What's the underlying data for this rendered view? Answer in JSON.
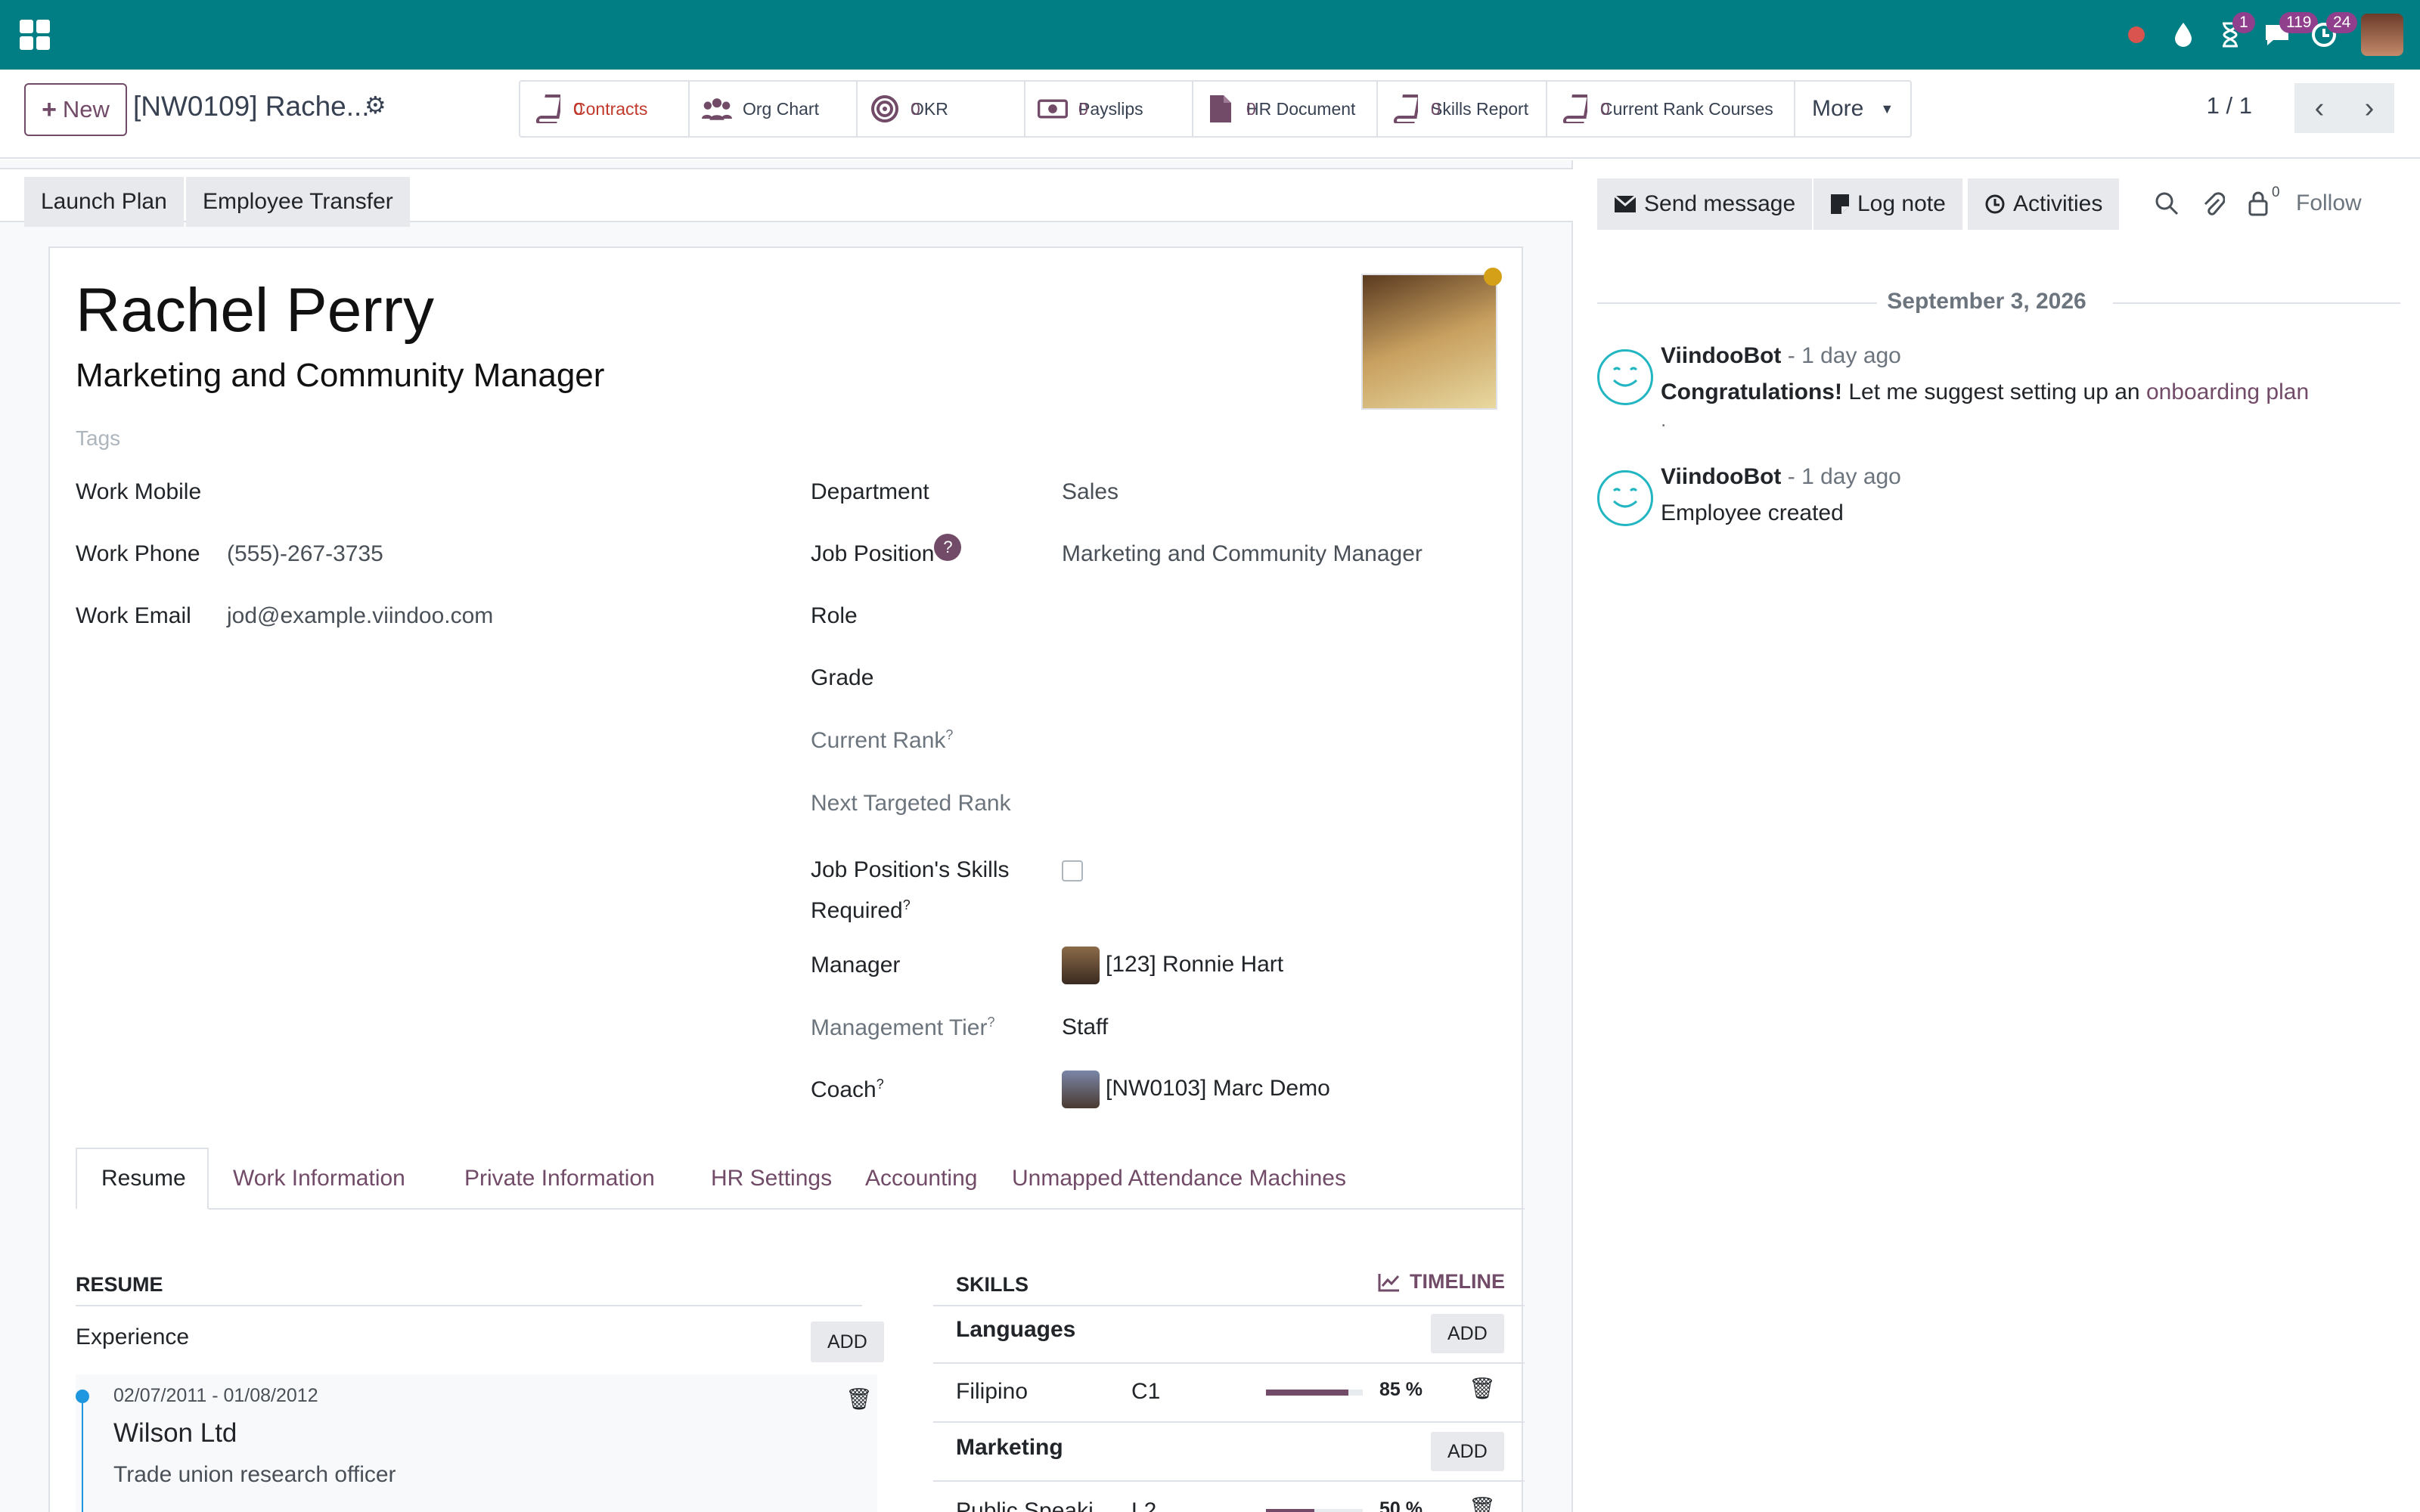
{
  "navbar": {
    "systray": [
      {
        "icon": "record-icon",
        "badge": ""
      },
      {
        "icon": "drop-icon",
        "badge": ""
      },
      {
        "icon": "hourglass-icon",
        "badge": "1"
      },
      {
        "icon": "chat-icon",
        "badge": "119"
      },
      {
        "icon": "activity-clock-icon",
        "badge": "24"
      }
    ]
  },
  "control_panel": {
    "new_label": "New",
    "breadcrumb": "[NW0109] Rache...",
    "smart_buttons": [
      {
        "label": "Contracts",
        "value": "0",
        "icon": "book-icon",
        "color": "#c0392b"
      },
      {
        "label": "Org Chart",
        "value": "",
        "icon": "users-icon"
      },
      {
        "label": "OKR",
        "value": "0",
        "icon": "target-icon"
      },
      {
        "label": "Payslips",
        "value": "0",
        "icon": "money-icon"
      },
      {
        "label": "HR Document",
        "value": "0",
        "icon": "file-icon"
      },
      {
        "label": "Skills Report",
        "value": "0",
        "icon": "book-icon"
      },
      {
        "label": "Current Rank Courses",
        "value": "0",
        "icon": "book-icon"
      }
    ],
    "more_label": "More",
    "pager": "1 / 1"
  },
  "statusbar": {
    "buttons": [
      "Launch Plan",
      "Employee Transfer"
    ]
  },
  "employee": {
    "name": "Rachel Perry",
    "job_title": "Marketing and Community Manager",
    "tags_placeholder": "Tags",
    "left_fields": [
      {
        "label": "Work Mobile",
        "value": ""
      },
      {
        "label": "Work Phone",
        "value": "(555)-267-3735"
      },
      {
        "label": "Work Email",
        "value": "jod@example.viindoo.com"
      }
    ],
    "department_label": "Department",
    "department": "Sales",
    "job_position_label": "Job Position",
    "job_position": "Marketing and Community Manager",
    "role_label": "Role",
    "grade_label": "Grade",
    "current_rank_label": "Current Rank",
    "next_rank_label": "Next Targeted Rank",
    "skills_required_label_1": "Job Position's Skills",
    "skills_required_label_2": "Required",
    "manager_label": "Manager",
    "manager": "[123] Ronnie Hart",
    "tier_label": "Management Tier",
    "tier": "Staff",
    "coach_label": "Coach",
    "coach": "[NW0103] Marc Demo",
    "help_mark": "?"
  },
  "tabs": [
    "Resume",
    "Work Information",
    "Private Information",
    "HR Settings",
    "Accounting",
    "Unmapped Attendance Machines"
  ],
  "resume": {
    "title": "RESUME",
    "experience_label": "Experience",
    "add_label": "ADD",
    "entries": [
      {
        "dates": "02/07/2011 - 01/08/2012",
        "company": "Wilson Ltd",
        "role": "Trade union research officer"
      }
    ]
  },
  "skills": {
    "title": "SKILLS",
    "timeline_label": "TIMELINE",
    "groups": [
      {
        "name": "Languages",
        "items": [
          {
            "skill": "Filipino",
            "level": "C1",
            "progress": 85,
            "progress_label": "85 %"
          }
        ]
      },
      {
        "name": "Marketing",
        "items": [
          {
            "skill": "Public Speaki...",
            "level": "L2",
            "progress": 50,
            "progress_label": "50 %"
          }
        ]
      }
    ]
  },
  "chatter": {
    "send_message": "Send message",
    "log_note": "Log note",
    "activities": "Activities",
    "followers_count": "0",
    "follow": "Follow",
    "date": "September 3, 2026",
    "messages": [
      {
        "author": "ViindooBot",
        "when": "- 1 day ago",
        "bold": "Congratulations!",
        "text": " Let me suggest setting up an ",
        "link": "onboarding plan",
        "tail": "."
      },
      {
        "author": "ViindooBot",
        "when": "- 1 day ago",
        "text": "Employee created"
      }
    ]
  }
}
